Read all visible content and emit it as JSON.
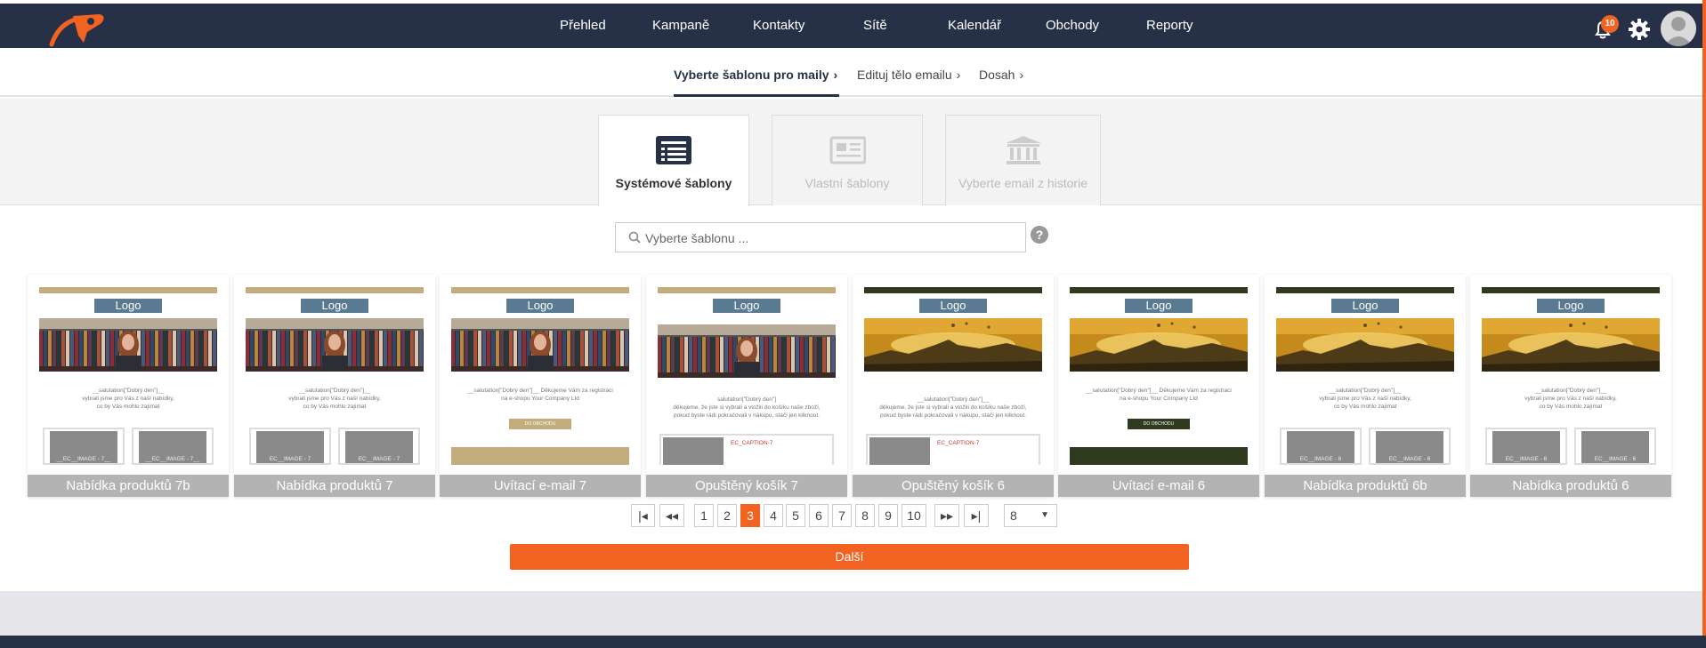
{
  "app": {
    "colors": {
      "navbar": "#263147",
      "accent": "#f26322",
      "card_caption": "#b3b3b3"
    }
  },
  "nav": {
    "items": [
      "Přehled",
      "Kampaně",
      "Kontakty",
      "Sítě",
      "Kalendář",
      "Obchody",
      "Reporty"
    ],
    "notifications_count": "10",
    "icons": [
      "bell-icon",
      "gear-icon",
      "user-avatar"
    ]
  },
  "wizard": {
    "steps": [
      "Vyberte šablonu pro maily",
      "Edituj tělo emailu",
      "Dosah"
    ],
    "separator": "›",
    "active": 0
  },
  "tabs": [
    {
      "label": "Systémové šablony",
      "icon": "list-icon",
      "active": true
    },
    {
      "label": "Vlastní šablony",
      "icon": "newspaper-icon",
      "active": false
    },
    {
      "label": "Vyberte email z historie",
      "icon": "bank-icon",
      "active": false
    }
  ],
  "search": {
    "placeholder": "Vyberte šablonu ..."
  },
  "templates": [
    {
      "name": "Nabídka produktů 7b",
      "theme": "tan",
      "greeting": "__salutation[\"Dobrý den\"]__",
      "line2": "vybrali jsme pro Vás z naší nabídky,",
      "line3": "co by Vás mohlo zajímat",
      "block": "__EC__IMAGE - 7__"
    },
    {
      "name": "Nabídka produktů 7",
      "theme": "tan",
      "greeting": "__salutation[\"Dobrý den\"]__",
      "line2": "vybrali jsme pro Vás z naší nabídky,",
      "line3": "co by Vás mohlo zajímat",
      "block": "EC__IMAGE - 7"
    },
    {
      "name": "Uvítací e-mail 7",
      "theme": "tan",
      "greeting": "__salutation[\"Dobrý den\"]__ Děkujeme Vám za registraci",
      "line2": "na e-shopu Your Company Ltd",
      "line3": "",
      "block": "DO OBCHODU"
    },
    {
      "name": "Opuštěný košík 7",
      "theme": "tan",
      "greeting": "salutation[\"Dobrý den\"]",
      "line2": "děkujeme, že jste si vybrali a vložili do košíku naše zboží,",
      "line3": "pokud byste rádi pokračovali v nákupu, stačí jen kliknout.",
      "block": "EC_CAPTION-7"
    },
    {
      "name": "Opuštěný košík 6",
      "theme": "dark",
      "greeting": "__salutation[\"Dobrý den\"]__",
      "line2": "děkujeme, že jste si vybrali a vložili do košíku naše zboží,",
      "line3": "pokud byste rádi pokračovali v nákupu, stačí jen kliknout.",
      "block": "EC_CAPTION-7"
    },
    {
      "name": "Uvítací e-mail 6",
      "theme": "dark",
      "greeting": "__salutation[\"Dobrý den\"]__ Děkujeme Vám za registraci",
      "line2": "na e-shopu Your Company Ltd",
      "line3": "",
      "block": "DO OBCHODU"
    },
    {
      "name": "Nabídka produktů 6b",
      "theme": "dark",
      "greeting": "__salutation[\"Dobrý den\"]__",
      "line2": "vybrali jsme pro Vás z naší nabídky,",
      "line3": "co by Vás mohlo zajímat",
      "block": "EC__IMAGE - 6"
    },
    {
      "name": "Nabídka produktů 6",
      "theme": "dark",
      "greeting": "__salutation[\"Dobrý den\"]__",
      "line2": "vybrali jsme pro Vás z naší nabídky,",
      "line3": "co by Vás mohlo zajímat",
      "block": "EC__IMAGE - 6"
    }
  ],
  "template_logo": "Logo",
  "pagination": {
    "first": "|◂",
    "prev": "◂◂",
    "next": "▸▸",
    "last": "▸|",
    "pages": [
      "1",
      "2",
      "3",
      "4",
      "5",
      "6",
      "7",
      "8",
      "9",
      "10"
    ],
    "current": "3",
    "per_page": "8"
  },
  "next_button": "Další"
}
